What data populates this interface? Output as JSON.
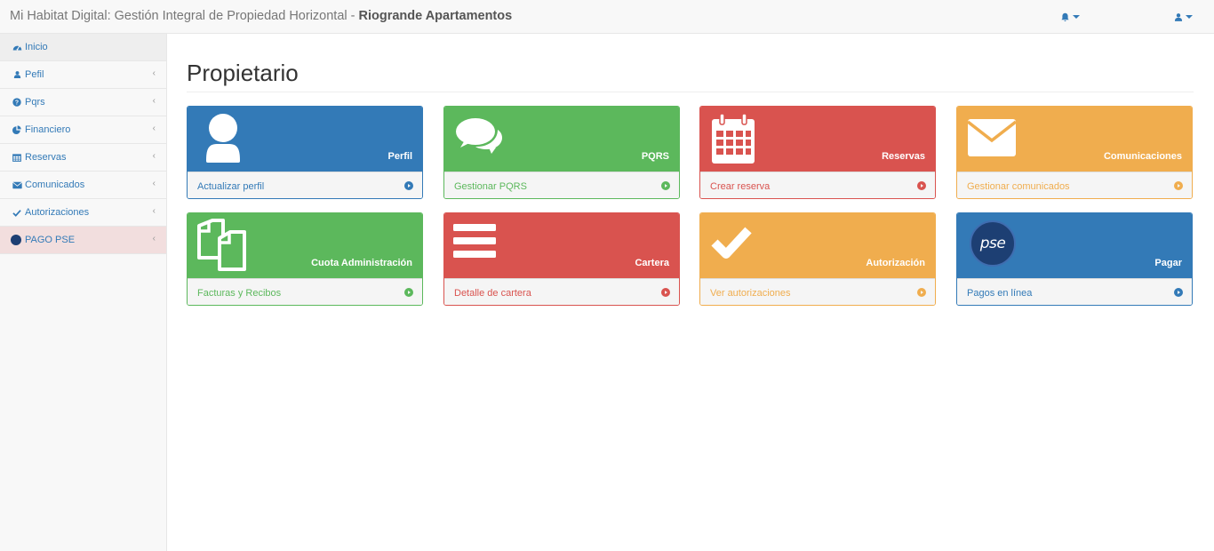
{
  "header": {
    "brand_prefix": "Mi Habitat Digital: Gestión Integral de Propiedad Horizontal - ",
    "brand_name": "Riogrande Apartamentos",
    "notifications_icon": "bell-icon",
    "user_icon": "user-icon"
  },
  "sidebar": {
    "items": [
      {
        "label": "Inicio",
        "icon": "dashboard-icon"
      },
      {
        "label": "Pefil",
        "icon": "user-icon"
      },
      {
        "label": "Pqrs",
        "icon": "question-circle-icon"
      },
      {
        "label": "Financiero",
        "icon": "pie-chart-icon"
      },
      {
        "label": "Reservas",
        "icon": "calendar-icon"
      },
      {
        "label": "Comunicados",
        "icon": "envelope-icon"
      },
      {
        "label": "Autorizaciones",
        "icon": "check-icon"
      },
      {
        "label": "PAGO PSE",
        "icon": "pse-logo-icon"
      }
    ]
  },
  "page": {
    "title": "Propietario"
  },
  "cards": [
    {
      "title": "Perfil",
      "link": "Actualizar perfil",
      "color": "#337ab7",
      "icon": "user-icon"
    },
    {
      "title": "PQRS",
      "link": "Gestionar PQRS",
      "color": "#5cb85c",
      "icon": "comments-icon"
    },
    {
      "title": "Reservas",
      "link": "Crear reserva",
      "color": "#d9534f",
      "icon": "calendar-icon"
    },
    {
      "title": "Comunicaciones",
      "link": "Gestionar comunicados",
      "color": "#f0ad4e",
      "icon": "envelope-icon"
    },
    {
      "title": "Cuota Administración",
      "link": "Facturas y Recibos",
      "color": "#5cb85c",
      "icon": "files-icon"
    },
    {
      "title": "Cartera",
      "link": "Detalle de cartera",
      "color": "#d9534f",
      "icon": "bars-icon"
    },
    {
      "title": "Autorización",
      "link": "Ver autorizaciones",
      "color": "#f0ad4e",
      "icon": "check-icon"
    },
    {
      "title": "Pagar",
      "link": "Pagos en línea",
      "color": "#337ab7",
      "icon": "pse-logo-icon",
      "logo_text": "pse"
    }
  ]
}
